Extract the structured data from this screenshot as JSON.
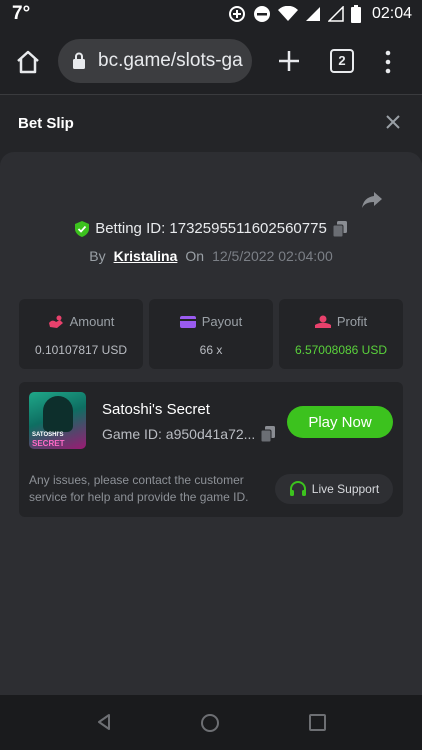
{
  "status_bar": {
    "temperature": "7°",
    "time": "02:04"
  },
  "browser": {
    "url": "bc.game/slots-ga",
    "tab_count": "2"
  },
  "bet_slip": {
    "title": "Bet Slip",
    "betting_id": "Betting ID: 1732595511602560775",
    "by_label": "By",
    "username": "Kristalina",
    "on_label": "On",
    "date": "12/5/2022 02:04:00",
    "stats": [
      {
        "label": "Amount",
        "value": "0.10107817 USD",
        "icon": "amount-icon",
        "icon_color": "#e8416c"
      },
      {
        "label": "Payout",
        "value": "66 x",
        "icon": "payout-icon",
        "icon_color": "#9a5bf0"
      },
      {
        "label": "Profit",
        "value": "6.57008086 USD",
        "icon": "profit-icon",
        "icon_color": "#e8416c"
      }
    ],
    "game": {
      "thumb_line1": "SATOSHI'S",
      "thumb_line2": "SECRET",
      "name": "Satoshi's Secret",
      "game_id": "Game ID: a950d41a72...",
      "play_label": "Play Now"
    },
    "help_text": "Any issues, please contact the customer service for help and provide the game ID.",
    "live_support_label": "Live Support"
  },
  "colors": {
    "accent_green": "#3cc21e",
    "profit_green": "#5ad23c",
    "shield_green": "#3cc21e"
  }
}
